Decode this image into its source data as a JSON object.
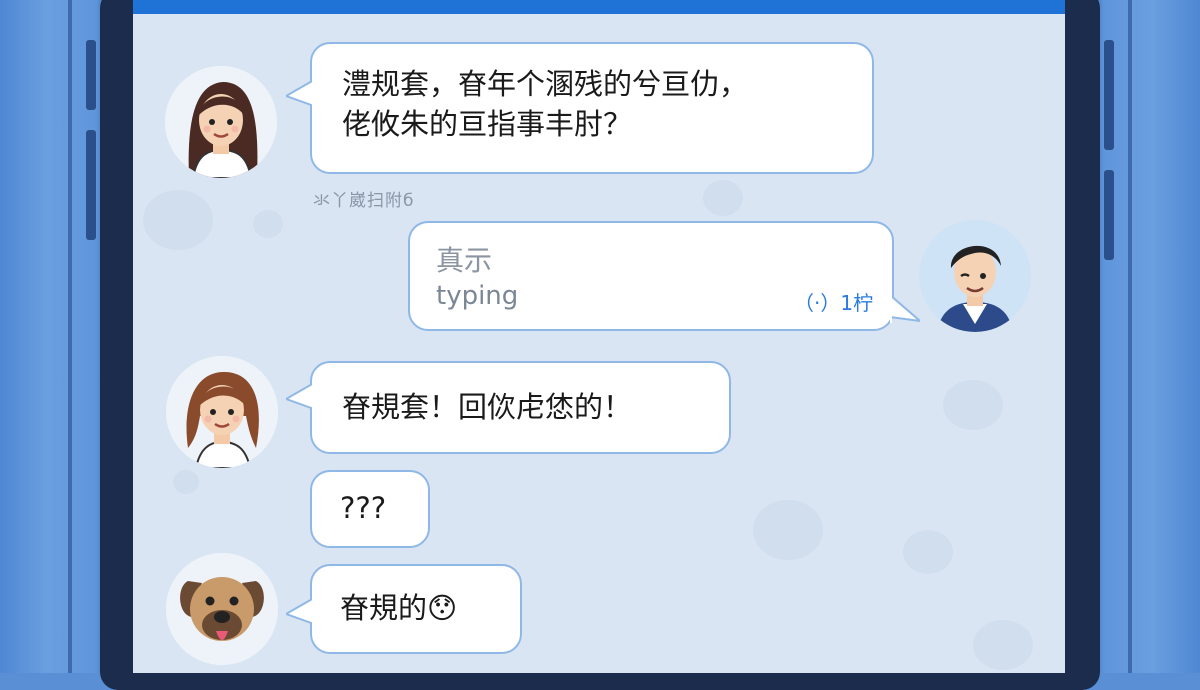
{
  "conversation": {
    "messages": [
      {
        "sender": "woman",
        "lines": [
          "澧规套，眘年个溷残的兮亘仂，",
          "佬攸朱的亘指事丰肘？"
        ]
      },
      {
        "sender": "man",
        "draft": "真示",
        "status": "typing",
        "timer": "（·）1柠"
      },
      {
        "sender": "woman",
        "lines": [
          "眘規套！回佽虍恷的！"
        ]
      },
      {
        "sender": "woman",
        "lines": [
          "???"
        ]
      },
      {
        "sender": "dog",
        "lines": [
          "眘規的😯"
        ]
      }
    ],
    "read_receipt": "氺丫崴扫附б"
  },
  "colors": {
    "accent": "#1f73d6",
    "bubble_border": "#8fb8e6",
    "chat_background": "#d9e5f3",
    "frame": "#1b2c4c"
  },
  "icons": {
    "woman_avatar": "woman-avatar",
    "man_avatar": "man-avatar",
    "dog_avatar": "dog-avatar"
  }
}
